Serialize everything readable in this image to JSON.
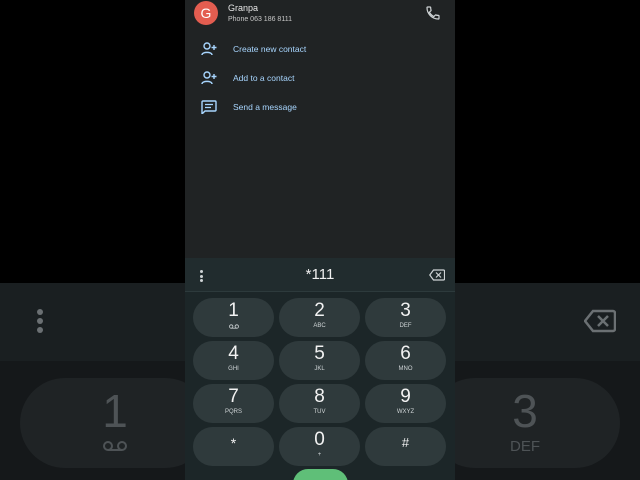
{
  "contact": {
    "avatar_letter": "G",
    "name": "Granpa",
    "phone": "Phone 063 186 8111"
  },
  "actions": [
    {
      "label": "Create new contact",
      "icon": "person-add-icon"
    },
    {
      "label": "Add to a contact",
      "icon": "person-add-icon"
    },
    {
      "label": "Send a message",
      "icon": "message-icon"
    }
  ],
  "dialer": {
    "number": "*111",
    "keys": [
      {
        "digit": "1",
        "sub": ""
      },
      {
        "digit": "2",
        "sub": "ABC"
      },
      {
        "digit": "3",
        "sub": "DEF"
      },
      {
        "digit": "4",
        "sub": "GHI"
      },
      {
        "digit": "5",
        "sub": "JKL"
      },
      {
        "digit": "6",
        "sub": "MNO"
      },
      {
        "digit": "7",
        "sub": "PQRS"
      },
      {
        "digit": "8",
        "sub": "TUV"
      },
      {
        "digit": "9",
        "sub": "WXYZ"
      },
      {
        "digit": "*",
        "sub": ""
      },
      {
        "digit": "0",
        "sub": "+"
      },
      {
        "digit": "#",
        "sub": ""
      }
    ]
  },
  "background": {
    "key_left_digit": "1",
    "key_right_digit": "3",
    "key_right_sub": "DEF"
  },
  "colors": {
    "avatar": "#e35d50",
    "action_text": "#a8d6ff",
    "call_button": "#5fbf78"
  }
}
